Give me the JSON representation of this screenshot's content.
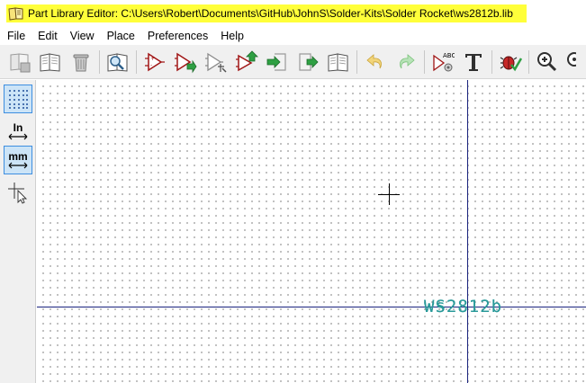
{
  "window": {
    "title": "Part Library Editor: C:\\Users\\Robert\\Documents\\GitHub\\JohnS\\Solder-Kits\\Solder Rocket\\ws2812b.lib",
    "title_highlight_color": "#ffff3a"
  },
  "menu": {
    "items": [
      "File",
      "Edit",
      "View",
      "Place",
      "Preferences",
      "Help"
    ]
  },
  "toolbar": {
    "icons": [
      "save-library-icon",
      "select-library-icon",
      "delete-part-icon",
      "library-browser-icon",
      "new-part-icon",
      "load-part-icon",
      "create-from-current-icon",
      "save-part-icon",
      "import-part-icon",
      "export-part-icon",
      "export-to-new-library-icon",
      "undo-icon",
      "redo-icon",
      "edit-properties-icon",
      "edit-fields-icon",
      "erc-check-icon",
      "zoom-in-icon",
      "zoom-auto-icon"
    ]
  },
  "lefttoolbar": {
    "inch_label": "In",
    "mm_label": "mm"
  },
  "canvas": {
    "reference_text": "WS2812b",
    "value_text": "ws2812b",
    "text_color": "#2a9a9a",
    "axis_color": "#1a237e"
  }
}
